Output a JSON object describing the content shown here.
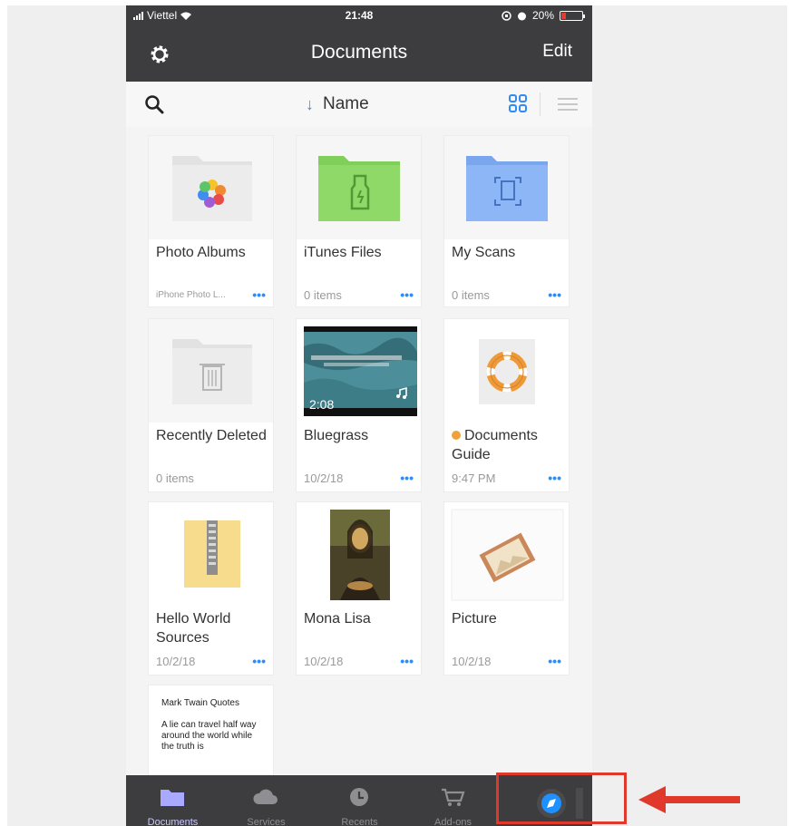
{
  "status_bar": {
    "carrier": "Viettel",
    "time": "21:48",
    "battery": "20%"
  },
  "nav": {
    "title": "Documents",
    "edit": "Edit",
    "settings_icon": "gear-icon"
  },
  "toolbar": {
    "sort_label": "Name",
    "sort_arrow": "↓"
  },
  "items": [
    {
      "name": "Photo Albums",
      "meta": "iPhone Photo L...",
      "icon": "photos-folder-icon",
      "more": "•••"
    },
    {
      "name": "iTunes Files",
      "meta": "0 items",
      "icon": "itunes-folder-icon",
      "more": "•••"
    },
    {
      "name": "My Scans",
      "meta": "0 items",
      "icon": "scans-folder-icon",
      "more": "•••"
    },
    {
      "name": "Recently Deleted",
      "meta": "0 items",
      "icon": "trash-folder-icon",
      "more": ""
    },
    {
      "name": "Bluegrass",
      "meta": "10/2/18",
      "icon": "video-thumbnail",
      "duration": "2:08",
      "more": "•••"
    },
    {
      "name": "Documents Guide",
      "meta": "9:47 PM",
      "icon": "lifebuoy-icon",
      "more": "•••"
    },
    {
      "name": "Hello World Sources",
      "meta": "10/2/18",
      "icon": "zip-file-icon",
      "more": "•••"
    },
    {
      "name": "Mona Lisa",
      "meta": "10/2/18",
      "icon": "image-thumbnail",
      "more": "•••"
    },
    {
      "name": "Picture",
      "meta": "10/2/18",
      "icon": "picture-file-icon",
      "more": "•••"
    }
  ],
  "text_preview": {
    "title": "Mark Twain Quotes",
    "body": "A lie can travel half way around the world while the truth is"
  },
  "tabs": [
    {
      "label": "Documents",
      "icon": "folder-icon",
      "active": true
    },
    {
      "label": "Services",
      "icon": "cloud-icon",
      "active": false
    },
    {
      "label": "Recents",
      "icon": "clock-icon",
      "active": false
    },
    {
      "label": "Add-ons",
      "icon": "cart-icon",
      "active": false
    },
    {
      "label": "",
      "icon": "compass-icon",
      "active": false
    }
  ],
  "colors": {
    "accent": "#2f8cf5",
    "bar": "#3d3d3f",
    "annotation": "#e0392b"
  }
}
